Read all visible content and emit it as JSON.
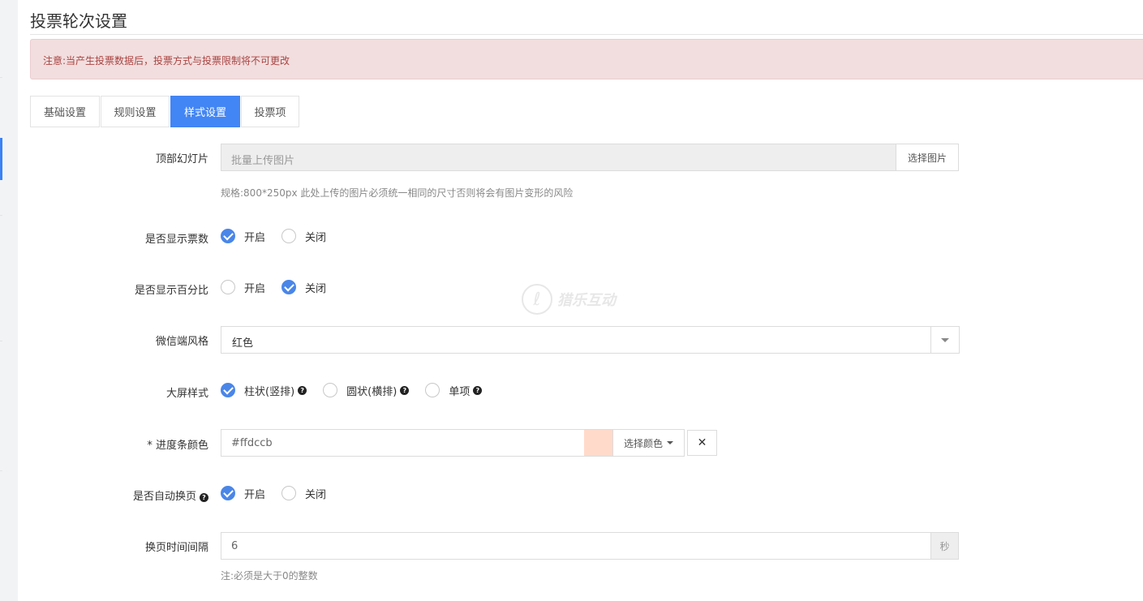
{
  "page": {
    "title": "投票轮次设置",
    "notice": "注意:当产生投票数据后，投票方式与投票限制将不可更改"
  },
  "tabs": [
    {
      "label": "基础设置",
      "active": false
    },
    {
      "label": "规则设置",
      "active": false
    },
    {
      "label": "样式设置",
      "active": true
    },
    {
      "label": "投票项",
      "active": false
    }
  ],
  "form": {
    "slideshow": {
      "label": "顶部幻灯片",
      "placeholder": "批量上传图片",
      "button": "选择图片",
      "hint": "规格:800*250px 此处上传的图片必须统一相同的尺寸否则将会有图片变形的风险"
    },
    "show_votes": {
      "label": "是否显示票数",
      "options": [
        "开启",
        "关闭"
      ],
      "selected": "开启"
    },
    "show_percent": {
      "label": "是否显示百分比",
      "options": [
        "开启",
        "关闭"
      ],
      "selected": "关闭"
    },
    "wechat_style": {
      "label": "微信端风格",
      "value": "红色"
    },
    "screen_style": {
      "label": "大屏样式",
      "options": [
        "柱状(竖排)",
        "圆状(横排)",
        "单项"
      ],
      "selected": "柱状(竖排)"
    },
    "progress_color": {
      "label": "* 进度条颜色",
      "value": "#ffdccb",
      "button": "选择颜色",
      "swatch": "#ffdacb"
    },
    "auto_page": {
      "label": "是否自动换页",
      "options": [
        "开启",
        "关闭"
      ],
      "selected": "开启"
    },
    "page_interval": {
      "label": "换页时间间隔",
      "value": "6",
      "unit": "秒",
      "hint": "注:必须是大于0的整数"
    }
  },
  "watermark": {
    "text": "猎乐互动"
  },
  "colors": {
    "accent": "#4285f4",
    "alert_bg": "#f2dede",
    "alert_text": "#a94442"
  }
}
